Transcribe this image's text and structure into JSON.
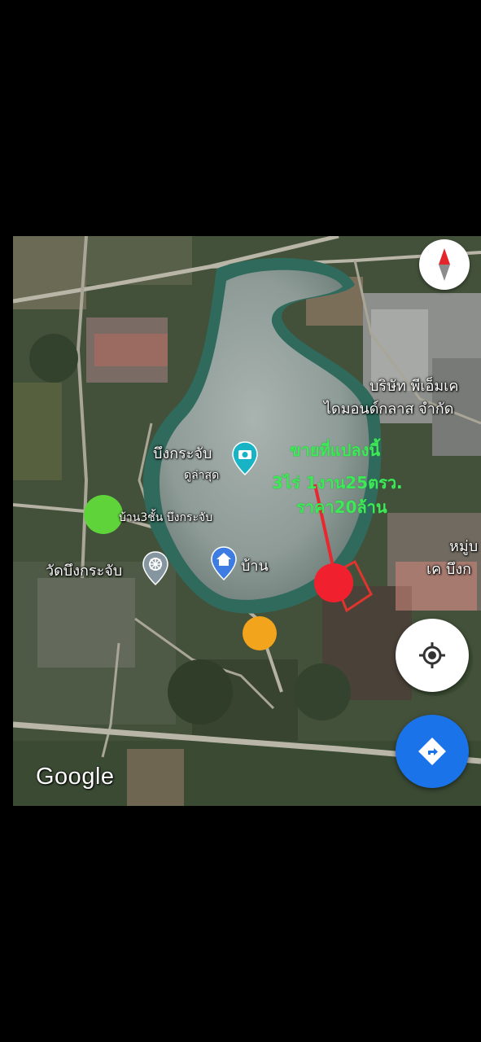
{
  "map": {
    "places": {
      "lake_name": "บึงกระจับ",
      "lake_sub": "ดูล่าสุด",
      "company_line1": "บริษัท พีเอ็มเค",
      "company_line2": "ไดมอนด์กลาส จำกัด",
      "house_3floor": "บ้าน3ชั้น บึงกระจับ",
      "temple": "วัดบึงกระจับ",
      "home": "บ้าน",
      "village_line1": "หมู่บ",
      "village_line2": "เค บึงก"
    },
    "overlay": {
      "line1": "ขายที่แปลงนี้",
      "line2": "3ไร่ 1งาน25ตรว.",
      "line3": "ราคา20ล้าน"
    },
    "markers": {
      "green": "#5fd43a",
      "orange": "#f2a51c",
      "red": "#f0202e",
      "sale_line": "#e8272f"
    },
    "icons": {
      "compass": "compass-icon",
      "locate": "my-location-icon",
      "directions": "directions-icon",
      "camera_pin": "camera-pin-icon",
      "home_pin": "home-pin-icon",
      "temple_pin": "dharma-wheel-pin-icon"
    },
    "attribution": "Google"
  }
}
